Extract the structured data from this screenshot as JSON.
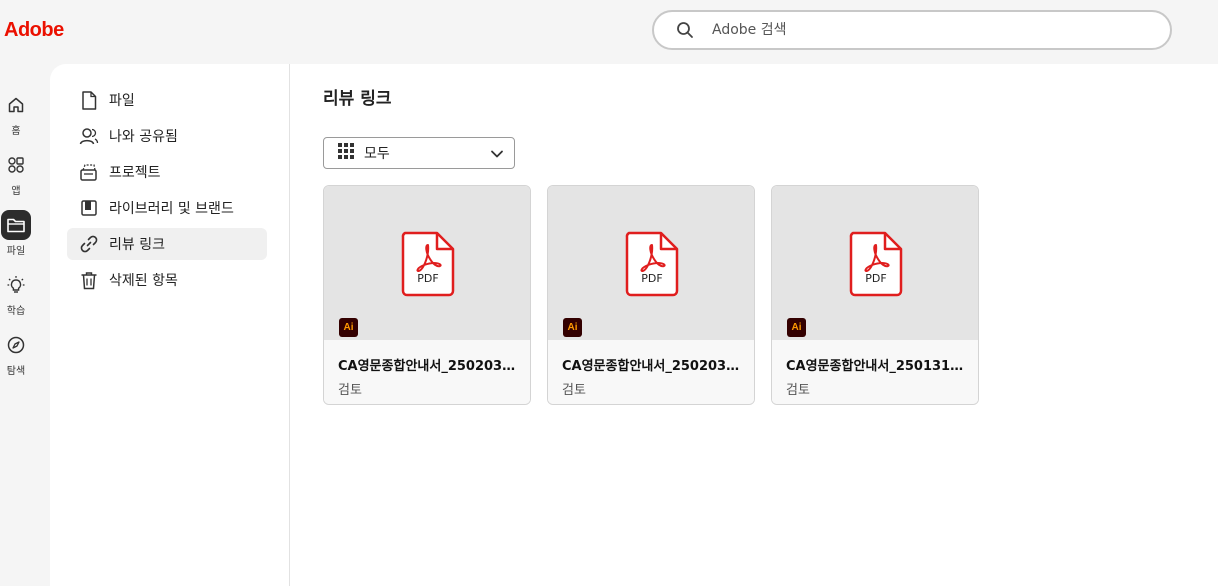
{
  "header": {
    "logo": "Adobe",
    "search_placeholder": "Adobe 검색"
  },
  "rail": [
    {
      "label": "홈",
      "icon": "home-icon"
    },
    {
      "label": "앱",
      "icon": "apps-icon"
    },
    {
      "label": "파일",
      "icon": "folder-icon",
      "active": true
    },
    {
      "label": "학습",
      "icon": "lightbulb-icon"
    },
    {
      "label": "탐색",
      "icon": "compass-icon"
    }
  ],
  "subnav": [
    {
      "label": "파일",
      "icon": "file-icon"
    },
    {
      "label": "나와 공유됨",
      "icon": "shared-user-icon"
    },
    {
      "label": "프로젝트",
      "icon": "project-icon"
    },
    {
      "label": "라이브러리 및 브랜드",
      "icon": "library-icon"
    },
    {
      "label": "리뷰 링크",
      "icon": "link-icon",
      "active": true
    },
    {
      "label": "삭제된 항목",
      "icon": "trash-icon"
    }
  ],
  "main": {
    "title": "리뷰 링크",
    "filter_label": "모두",
    "cards": [
      {
        "name": "CA영문종합안내서_250203_...",
        "status": "검토",
        "file_type": "PDF",
        "app_badge": "Ai"
      },
      {
        "name": "CA영문종합안내서_250203_...",
        "status": "검토",
        "file_type": "PDF",
        "app_badge": "Ai"
      },
      {
        "name": "CA영문종합안내서_250131_...",
        "status": "검토",
        "file_type": "PDF",
        "app_badge": "Ai"
      }
    ]
  },
  "colors": {
    "brand": "#eb1000",
    "pdf_red": "#e01e1e",
    "ai_badge_bg": "#330000",
    "ai_badge_fg": "#ff9a00",
    "active_rail": "#2c2c2c"
  }
}
